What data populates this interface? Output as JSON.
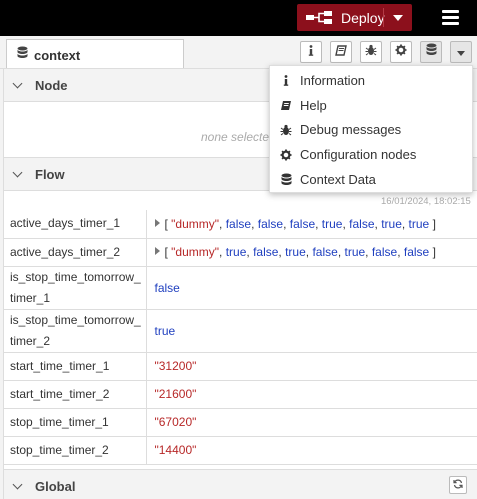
{
  "header": {
    "deploy_label": "Deploy"
  },
  "sidebar": {
    "tab_label": "context",
    "tab_buttons": [
      "info-icon",
      "book-icon",
      "bug-icon",
      "gear-icon",
      "database-icon",
      "chevron-down-icon"
    ]
  },
  "node_section": {
    "title": "Node",
    "empty_text": "none selecte"
  },
  "flow_section": {
    "title": "Flow",
    "timestamp": "16/01/2024, 18:02:15",
    "rows": [
      {
        "key": "active_days_timer_1",
        "type": "array",
        "items": [
          {
            "t": "str",
            "v": "\"dummy\""
          },
          {
            "t": "bool",
            "v": "false"
          },
          {
            "t": "bool",
            "v": "false"
          },
          {
            "t": "bool",
            "v": "false"
          },
          {
            "t": "bool",
            "v": "true"
          },
          {
            "t": "bool",
            "v": "false"
          },
          {
            "t": "bool",
            "v": "true"
          },
          {
            "t": "bool",
            "v": "true"
          }
        ]
      },
      {
        "key": "active_days_timer_2",
        "type": "array",
        "items": [
          {
            "t": "str",
            "v": "\"dummy\""
          },
          {
            "t": "bool",
            "v": "true"
          },
          {
            "t": "bool",
            "v": "false"
          },
          {
            "t": "bool",
            "v": "true"
          },
          {
            "t": "bool",
            "v": "false"
          },
          {
            "t": "bool",
            "v": "true"
          },
          {
            "t": "bool",
            "v": "false"
          },
          {
            "t": "bool",
            "v": "false"
          }
        ]
      },
      {
        "key": "is_stop_time_tomorrow_timer_1",
        "type": "bool",
        "value": "false"
      },
      {
        "key": "is_stop_time_tomorrow_timer_2",
        "type": "bool",
        "value": "true"
      },
      {
        "key": "start_time_timer_1",
        "type": "str",
        "value": "\"31200\""
      },
      {
        "key": "start_time_timer_2",
        "type": "str",
        "value": "\"21600\""
      },
      {
        "key": "stop_time_timer_1",
        "type": "str",
        "value": "\"67020\""
      },
      {
        "key": "stop_time_timer_2",
        "type": "str",
        "value": "\"14400\""
      }
    ]
  },
  "global_section": {
    "title": "Global"
  },
  "dropdown_menu": {
    "items": [
      {
        "icon": "info-icon",
        "label": "Information"
      },
      {
        "icon": "book-icon",
        "label": "Help"
      },
      {
        "icon": "bug-icon",
        "label": "Debug messages"
      },
      {
        "icon": "gear-icon",
        "label": "Configuration nodes"
      },
      {
        "icon": "database-icon",
        "label": "Context Data"
      }
    ]
  },
  "colors": {
    "deploy_bg": "#8c101c",
    "header_bg": "#000000",
    "string_value": "#b72828",
    "bool_value": "#1f3fbf"
  }
}
